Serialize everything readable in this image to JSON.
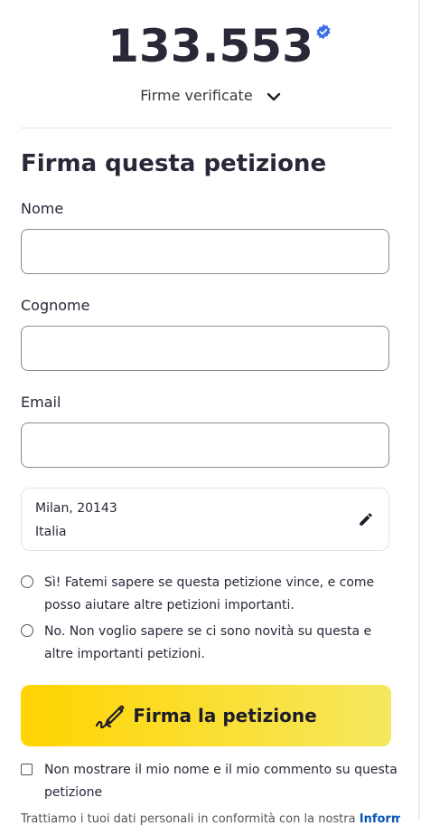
{
  "signatures": {
    "count": "133.553",
    "verified_label": "Firme verificate"
  },
  "form": {
    "title": "Firma questa petizione",
    "first_name_label": "Nome",
    "first_name_value": "",
    "last_name_label": "Cognome",
    "last_name_value": "",
    "email_label": "Email",
    "email_value": "",
    "location": {
      "city": "Milan, 20143",
      "country": "Italia"
    },
    "opt_in_yes": "Sì! Fatemi sapere se questa petizione vince, e come posso aiutare altre petizioni importanti.",
    "opt_in_no": "No. Non voglio sapere se ci sono novità su questa e altre importanti petizioni.",
    "sign_button": "Firma la petizione",
    "hide_name_label": "Non mostrare il mio nome e il mio commento su questa petizione",
    "footer_text": "Trattiamo i tuoi dati personali in conformità con la nostra",
    "footer_link": "Informativa"
  },
  "colors": {
    "button_gradient_start": "#ffd400",
    "button_gradient_end": "#f6e860",
    "verified_badge": "#3d71e9",
    "link": "#0a55b7"
  }
}
